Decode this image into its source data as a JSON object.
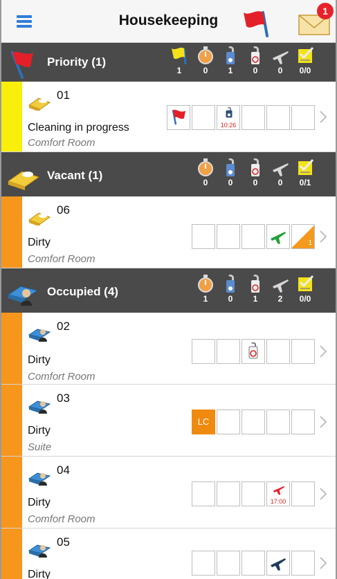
{
  "header": {
    "title": "Housekeeping",
    "notification_count": "1",
    "menu_icon": "hamburger-icon",
    "flag_icon": "red-flag-icon",
    "mail_icon": "envelope-icon"
  },
  "colors": {
    "priority_stripe": "#f9ef0a",
    "room_stripe": "#f7961c",
    "section_bg": "#4a4a4a",
    "accent": "#2f7ed8"
  },
  "sections": [
    {
      "title": "Priority (1)",
      "stats": [
        {
          "icon": "yellow-flag-icon",
          "count": "1"
        },
        {
          "icon": "stopwatch-icon",
          "count": "0"
        },
        {
          "icon": "do-not-disturb-icon",
          "count": "1"
        },
        {
          "icon": "privacy-sign-icon",
          "count": "0"
        },
        {
          "icon": "airplane-icon",
          "count": "0"
        },
        {
          "icon": "checklist-icon",
          "count": "0/0"
        }
      ],
      "rooms": [
        {
          "number": "01",
          "status": "Cleaning in progress",
          "type": "Comfort Room",
          "indicator_time": "10:26"
        }
      ]
    },
    {
      "title": "Vacant (1)",
      "stats": [
        {
          "icon": "stopwatch-icon",
          "count": "0"
        },
        {
          "icon": "do-not-disturb-icon",
          "count": "0"
        },
        {
          "icon": "privacy-sign-icon",
          "count": "0"
        },
        {
          "icon": "airplane-icon",
          "count": "0"
        },
        {
          "icon": "checklist-icon",
          "count": "0/1"
        }
      ],
      "rooms": [
        {
          "number": "06",
          "status": "Dirty",
          "type": "Comfort Room",
          "indicator_count": "1"
        }
      ]
    },
    {
      "title": "Occupied (4)",
      "stats": [
        {
          "icon": "stopwatch-icon",
          "count": "1"
        },
        {
          "icon": "do-not-disturb-icon",
          "count": "0"
        },
        {
          "icon": "privacy-sign-icon",
          "count": "1"
        },
        {
          "icon": "airplane-icon",
          "count": "2"
        },
        {
          "icon": "checklist-icon",
          "count": "0/0"
        }
      ],
      "rooms": [
        {
          "number": "02",
          "status": "Dirty",
          "type": "Comfort Room"
        },
        {
          "number": "03",
          "status": "Dirty",
          "type": "Suite",
          "indicator_label": "LC"
        },
        {
          "number": "04",
          "status": "Dirty",
          "type": "Comfort Room",
          "indicator_time": "17:00"
        },
        {
          "number": "05",
          "status": "Dirty"
        }
      ]
    }
  ]
}
